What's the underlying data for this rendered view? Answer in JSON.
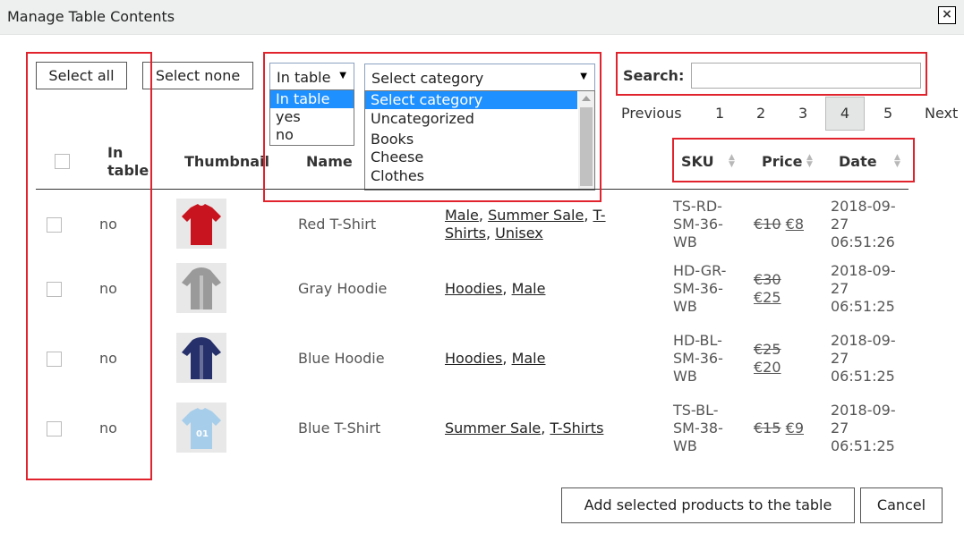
{
  "dialog": {
    "title": "Manage Table Contents",
    "close_label": "×"
  },
  "toolbar": {
    "select_all": "Select all",
    "select_none": "Select none"
  },
  "filters": {
    "in_table": {
      "selected": "In table",
      "options": [
        "In table",
        "yes",
        "no"
      ]
    },
    "category": {
      "selected": "Select category",
      "options": [
        "Select category",
        "Uncategorized",
        "Books",
        "Cheese",
        "Clothes"
      ]
    }
  },
  "search": {
    "label": "Search:",
    "value": ""
  },
  "pagination": {
    "previous": "Previous",
    "pages": [
      "1",
      "2",
      "3",
      "4",
      "5"
    ],
    "current": "4",
    "next": "Next"
  },
  "table": {
    "headers": {
      "in_table": "In table",
      "thumbnail": "Thumbnail",
      "name": "Name",
      "sku": "SKU",
      "price": "Price",
      "date": "Date"
    },
    "rows": [
      {
        "in_table": "no",
        "name": "Red T-Shirt",
        "categories": [
          "Male",
          "Summer Sale",
          "T-Shirts",
          "Unisex"
        ],
        "sku": [
          "TS-RD-",
          "SM-36-",
          "WB"
        ],
        "price_old": "€10",
        "price_new": "€8",
        "date": [
          "2018-09-",
          "27",
          "06:51:26"
        ],
        "shirt_color": "#c8141e"
      },
      {
        "in_table": "no",
        "name": "Gray Hoodie",
        "categories": [
          "Hoodies",
          "Male"
        ],
        "sku": [
          "HD-GR-",
          "SM-36-",
          "WB"
        ],
        "price_old": "€30",
        "price_new": "€25",
        "date": [
          "2018-09-",
          "27",
          "06:51:25"
        ],
        "shirt_color": "#9a9a9a"
      },
      {
        "in_table": "no",
        "name": "Blue Hoodie",
        "categories": [
          "Hoodies",
          "Male"
        ],
        "sku": [
          "HD-BL-",
          "SM-36-",
          "WB"
        ],
        "price_old": "€25",
        "price_new": "€20",
        "date": [
          "2018-09-",
          "27",
          "06:51:25"
        ],
        "shirt_color": "#26306a"
      },
      {
        "in_table": "no",
        "name": "Blue T-Shirt",
        "categories": [
          "Summer Sale",
          "T-Shirts"
        ],
        "sku": [
          "TS-BL-",
          "SM-38-",
          "WB"
        ],
        "price_old": "€15",
        "price_new": "€9",
        "date": [
          "2018-09-",
          "27",
          "06:51:25"
        ],
        "shirt_color": "#a6cdea"
      }
    ]
  },
  "footer": {
    "add_button": "Add selected products to the table",
    "cancel_button": "Cancel"
  },
  "colors": {
    "highlight_box": "#e0232d",
    "option_selected": "#1e90ff"
  }
}
